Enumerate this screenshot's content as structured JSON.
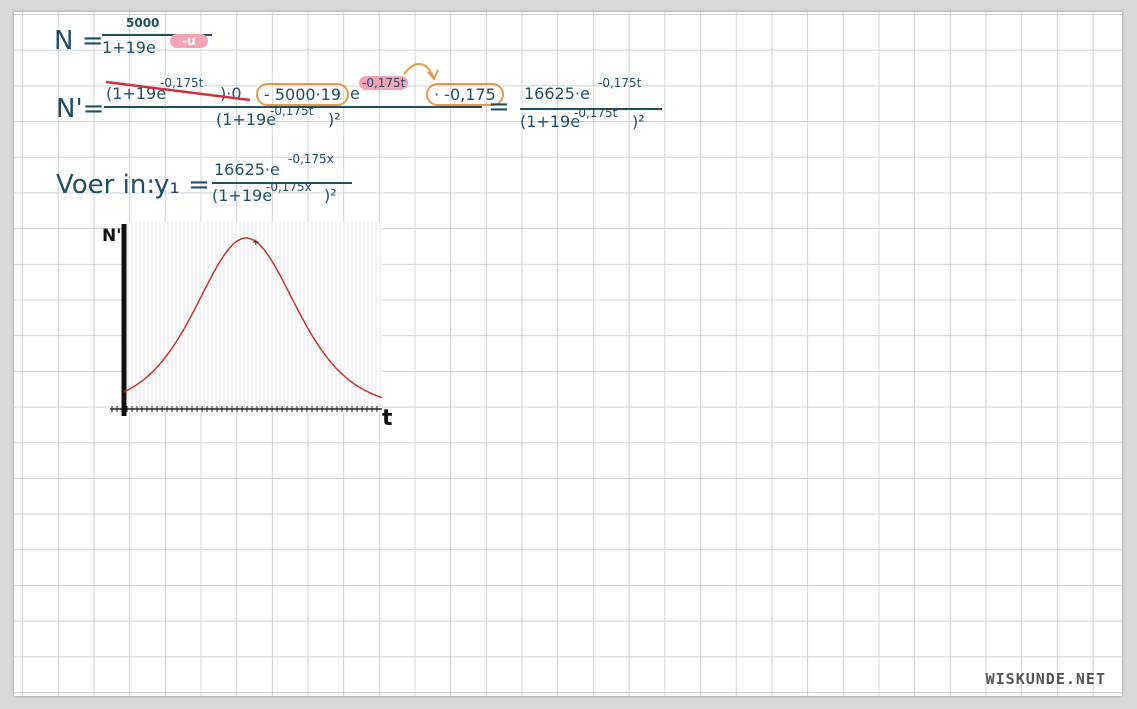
{
  "colors": {
    "ink": "#1f4e66",
    "curve": "#c0392b",
    "highlight_orange": "#e59a4a",
    "highlight_pink": "#f4a3b5",
    "strike_red": "#d0303a",
    "graph_bg_lines": "#e6e6ee"
  },
  "eq1": {
    "lhs": "N =",
    "numerator": "5000",
    "denominator": "1+19e",
    "exponent": "-u"
  },
  "eq2": {
    "lhs": "N'=",
    "numerator_part1": "(1+19e",
    "numerator_part1_exp": "-0,175t",
    "numerator_part1_tail": ")·0",
    "numerator_part2": "- 5000·19",
    "numerator_part3": "e",
    "numerator_part3_exp": "-0,175t",
    "numerator_part4": "· -0,175",
    "denominator": "(1+19e",
    "denominator_exp": "-0,175t",
    "denominator_tail": ")²",
    "equals": "=",
    "result_numerator": "16625·e",
    "result_numerator_exp": "-0,175t",
    "result_denominator": "(1+19e",
    "result_denominator_exp": "-0,175t",
    "result_denominator_tail": ")²"
  },
  "eq3": {
    "prefix": "Voer in:",
    "y_label": "y₁ =",
    "numerator": "16625·e",
    "numerator_exp": "-0,175x",
    "denominator": "(1+19e",
    "denominator_exp": "-0,175x",
    "denominator_tail": ")²"
  },
  "graph": {
    "y_axis_label": "N'",
    "x_axis_label": "t",
    "peak_marker": "+"
  },
  "logo": "WISKUNDE.NET"
}
